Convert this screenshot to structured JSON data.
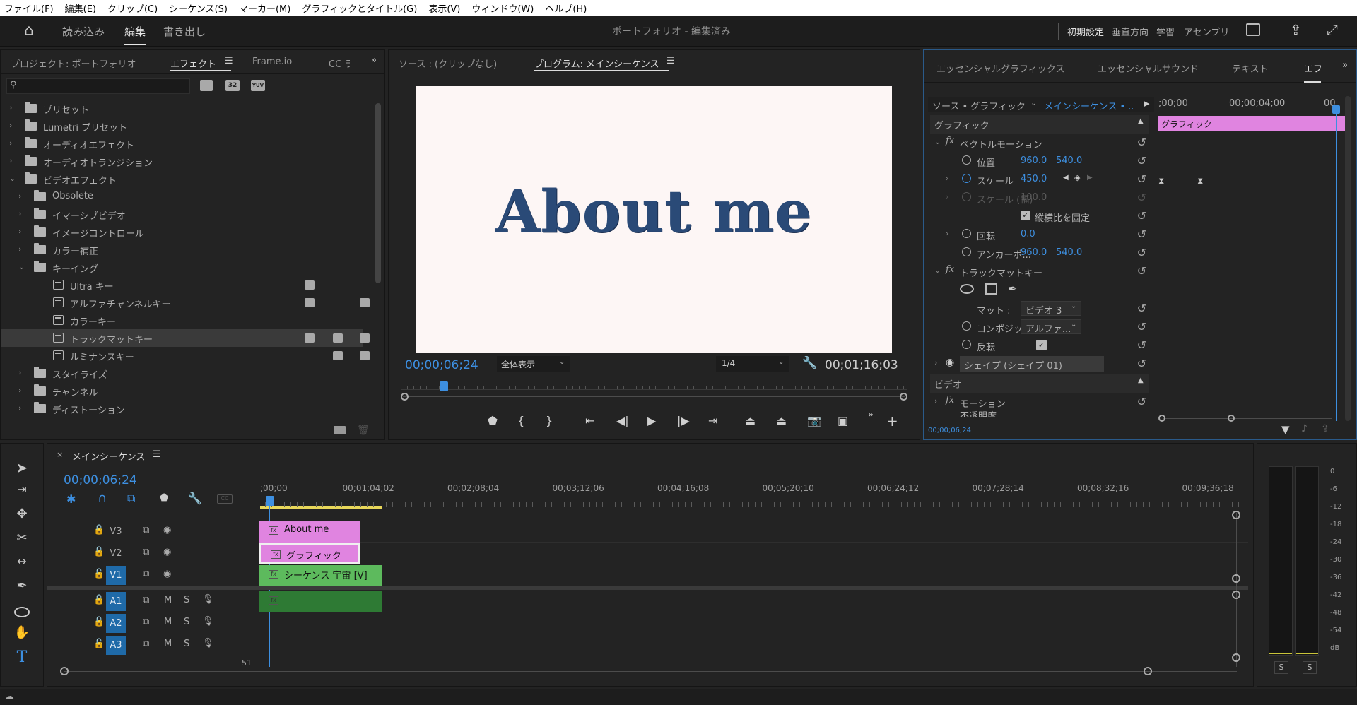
{
  "menubar": {
    "items": [
      "ファイル(F)",
      "編集(E)",
      "クリップ(C)",
      "シーケンス(S)",
      "マーカー(M)",
      "グラフィックとタイトル(G)",
      "表示(V)",
      "ウィンドウ(W)",
      "ヘルプ(H)"
    ]
  },
  "header": {
    "tabs": [
      "読み込み",
      "編集",
      "書き出し"
    ],
    "project_title": "ポートフォリオ - 編集済み",
    "workspaces": [
      "初期設定",
      "垂直方向",
      "学習",
      "アセンブリ"
    ]
  },
  "left_panel": {
    "tabs": [
      "プロジェクト: ポートフォリオ",
      "エフェクト",
      "Frame.io",
      "CC ライ"
    ],
    "search_placeholder": "",
    "filter_buttons": [
      "32",
      "YUV"
    ],
    "tree": [
      {
        "label": "プリセット",
        "level": 0,
        "expanded": false,
        "kind": "folder"
      },
      {
        "label": "Lumetri プリセット",
        "level": 0,
        "expanded": false,
        "kind": "folder"
      },
      {
        "label": "オーディオエフェクト",
        "level": 0,
        "expanded": false,
        "kind": "folder"
      },
      {
        "label": "オーディオトランジション",
        "level": 0,
        "expanded": false,
        "kind": "folder"
      },
      {
        "label": "ビデオエフェクト",
        "level": 0,
        "expanded": true,
        "kind": "folder"
      },
      {
        "label": "Obsolete",
        "level": 1,
        "expanded": false,
        "kind": "folder"
      },
      {
        "label": "イマーシブビデオ",
        "level": 1,
        "expanded": false,
        "kind": "folder"
      },
      {
        "label": "イメージコントロール",
        "level": 1,
        "expanded": false,
        "kind": "folder"
      },
      {
        "label": "カラー補正",
        "level": 1,
        "expanded": false,
        "kind": "folder"
      },
      {
        "label": "キーイング",
        "level": 1,
        "expanded": true,
        "kind": "folder"
      },
      {
        "label": "Ultra キー",
        "level": 2,
        "kind": "effect",
        "badges": [
          1
        ]
      },
      {
        "label": "アルファチャンネルキー",
        "level": 2,
        "kind": "effect",
        "badges": [
          1,
          3
        ]
      },
      {
        "label": "カラーキー",
        "level": 2,
        "kind": "effect",
        "badges": []
      },
      {
        "label": "トラックマットキー",
        "level": 2,
        "kind": "effect",
        "badges": [
          1,
          2,
          3
        ],
        "selected": true
      },
      {
        "label": "ルミナンスキー",
        "level": 2,
        "kind": "effect",
        "badges": [
          2,
          3
        ]
      },
      {
        "label": "スタイライズ",
        "level": 1,
        "expanded": false,
        "kind": "folder"
      },
      {
        "label": "チャンネル",
        "level": 1,
        "expanded": false,
        "kind": "folder"
      },
      {
        "label": "ディストーション",
        "level": 1,
        "expanded": false,
        "kind": "folder"
      }
    ]
  },
  "program_monitor": {
    "tabs": [
      "ソース : (クリップなし)",
      "プログラム: メインシーケンス"
    ],
    "frame_text": "About me",
    "timecode": "00;00;06;24",
    "fit": "全体表示",
    "resolution": "1/4",
    "duration": "00;01;16;03",
    "playhead_fraction": 0.08
  },
  "effect_controls": {
    "tabs": [
      "エッセンシャルグラフィックス",
      "エッセンシャルサウンド",
      "テキスト",
      "エフ"
    ],
    "source_label": "ソース • グラフィック",
    "sequence_label": "メインシーケンス • ...",
    "ruler_times": [
      ";00;00",
      "00;00;04;00",
      "00"
    ],
    "clip_label": "グラフィック",
    "section_graphic": "グラフィック",
    "vector_motion": "ベクトルモーション",
    "position_label": "位置",
    "position_x": "960.0",
    "position_y": "540.0",
    "scale_label": "スケール",
    "scale_value": "450.0",
    "scale_w_label": "スケール (幅)",
    "scale_w_value": "100.0",
    "uniform_label": "縦横比を固定",
    "rotation_label": "回転",
    "rotation_value": "0.0",
    "anchor_label": "アンカーポ...",
    "anchor_x": "960.0",
    "anchor_y": "540.0",
    "track_matte": "トラックマットキー",
    "matte_label": "マット :",
    "matte_value": "ビデオ 3",
    "composite_label": "コンポジッ...",
    "composite_value": "アルファ...",
    "invert_label": "反転",
    "shape_label": "シェイプ (シェイプ 01)",
    "section_video": "ビデオ",
    "motion_label": "モーション",
    "opacity_label": "不透明度",
    "footer_tc": "00;00;06;24"
  },
  "timeline": {
    "tab": "メインシーケンス",
    "timecode": "00;00;06;24",
    "ruler": [
      ";00;00",
      "00;01;04;02",
      "00;02;08;04",
      "00;03;12;06",
      "00;04;16;08",
      "00;05;20;10",
      "00;06;24;12",
      "00;07;28;14",
      "00;08;32;16",
      "00;09;36;18"
    ],
    "video_tracks": [
      {
        "name": "V3",
        "target": false
      },
      {
        "name": "V2",
        "target": false
      },
      {
        "name": "V1",
        "target": true
      }
    ],
    "audio_tracks": [
      {
        "name": "A1"
      },
      {
        "name": "A2"
      },
      {
        "name": "A3"
      }
    ],
    "clips": [
      {
        "track": "V3",
        "label": "About me",
        "color": "#e084e0"
      },
      {
        "track": "V2",
        "label": "グラフィック",
        "color": "#e084e0"
      },
      {
        "track": "V1",
        "label": "シーケンス 宇宙 [V]",
        "color": "#5dba5d"
      },
      {
        "track": "A1",
        "label": "",
        "color": "#2e7a34"
      }
    ],
    "partial_track_number": "51"
  },
  "audio_meter": {
    "scale": [
      "0",
      "-6",
      "-12",
      "-18",
      "-24",
      "-30",
      "-36",
      "-42",
      "-48",
      "-54",
      "dB"
    ],
    "solo": [
      "S",
      "S"
    ]
  },
  "colors": {
    "accent": "#3d8fe0",
    "clip_pink": "#e084e0",
    "clip_green": "#5dba5d",
    "track_target": "#1f6aa8"
  }
}
